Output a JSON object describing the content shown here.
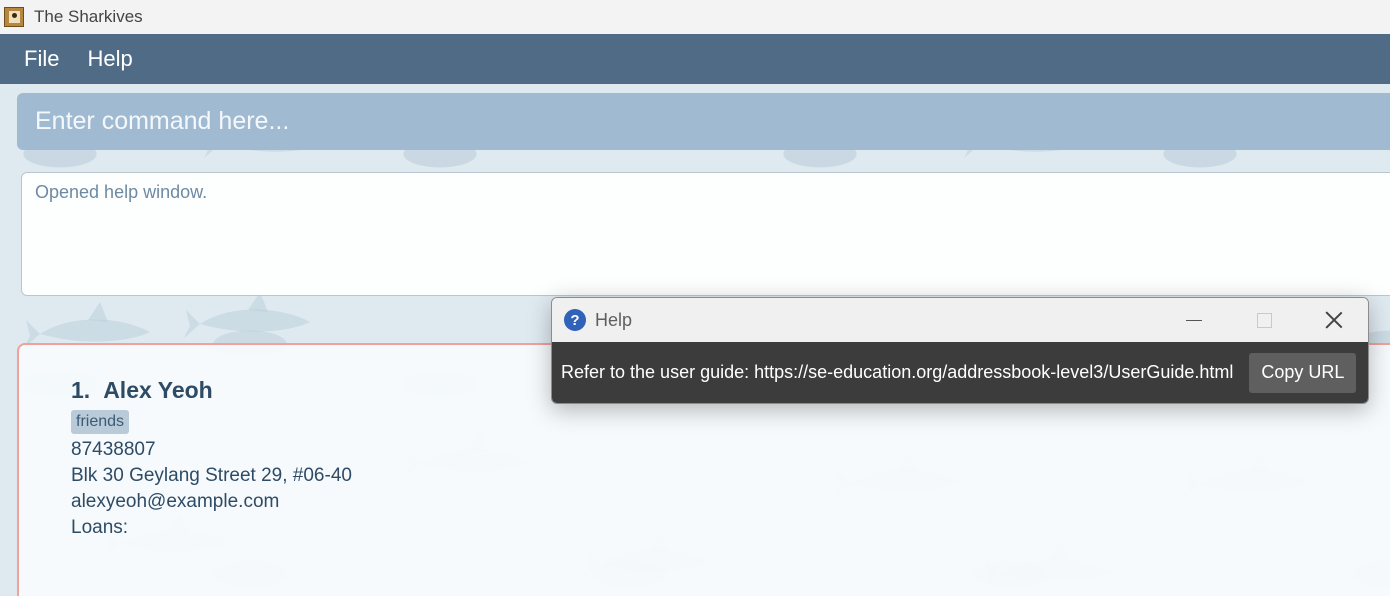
{
  "window": {
    "title": "The Sharkives"
  },
  "menu": {
    "items": [
      "File",
      "Help"
    ]
  },
  "command": {
    "placeholder": "Enter command here..."
  },
  "result": {
    "text": "Opened help window."
  },
  "persons": [
    {
      "index": "1.",
      "name": "Alex Yeoh",
      "tags": [
        "friends"
      ],
      "phone": "87438807",
      "address": "Blk 30 Geylang Street 29, #06-40",
      "email": "alexyeoh@example.com",
      "loans_label": "Loans:"
    }
  ],
  "help_window": {
    "title": "Help",
    "message": "Refer to the user guide: https://se-education.org/addressbook-level3/UserGuide.html",
    "copy_button": "Copy URL"
  },
  "colors": {
    "menubar": "#4f6b85",
    "command_box": "#a0bad1",
    "card_border": "#f2a19a",
    "help_body": "#3c3c3c"
  }
}
